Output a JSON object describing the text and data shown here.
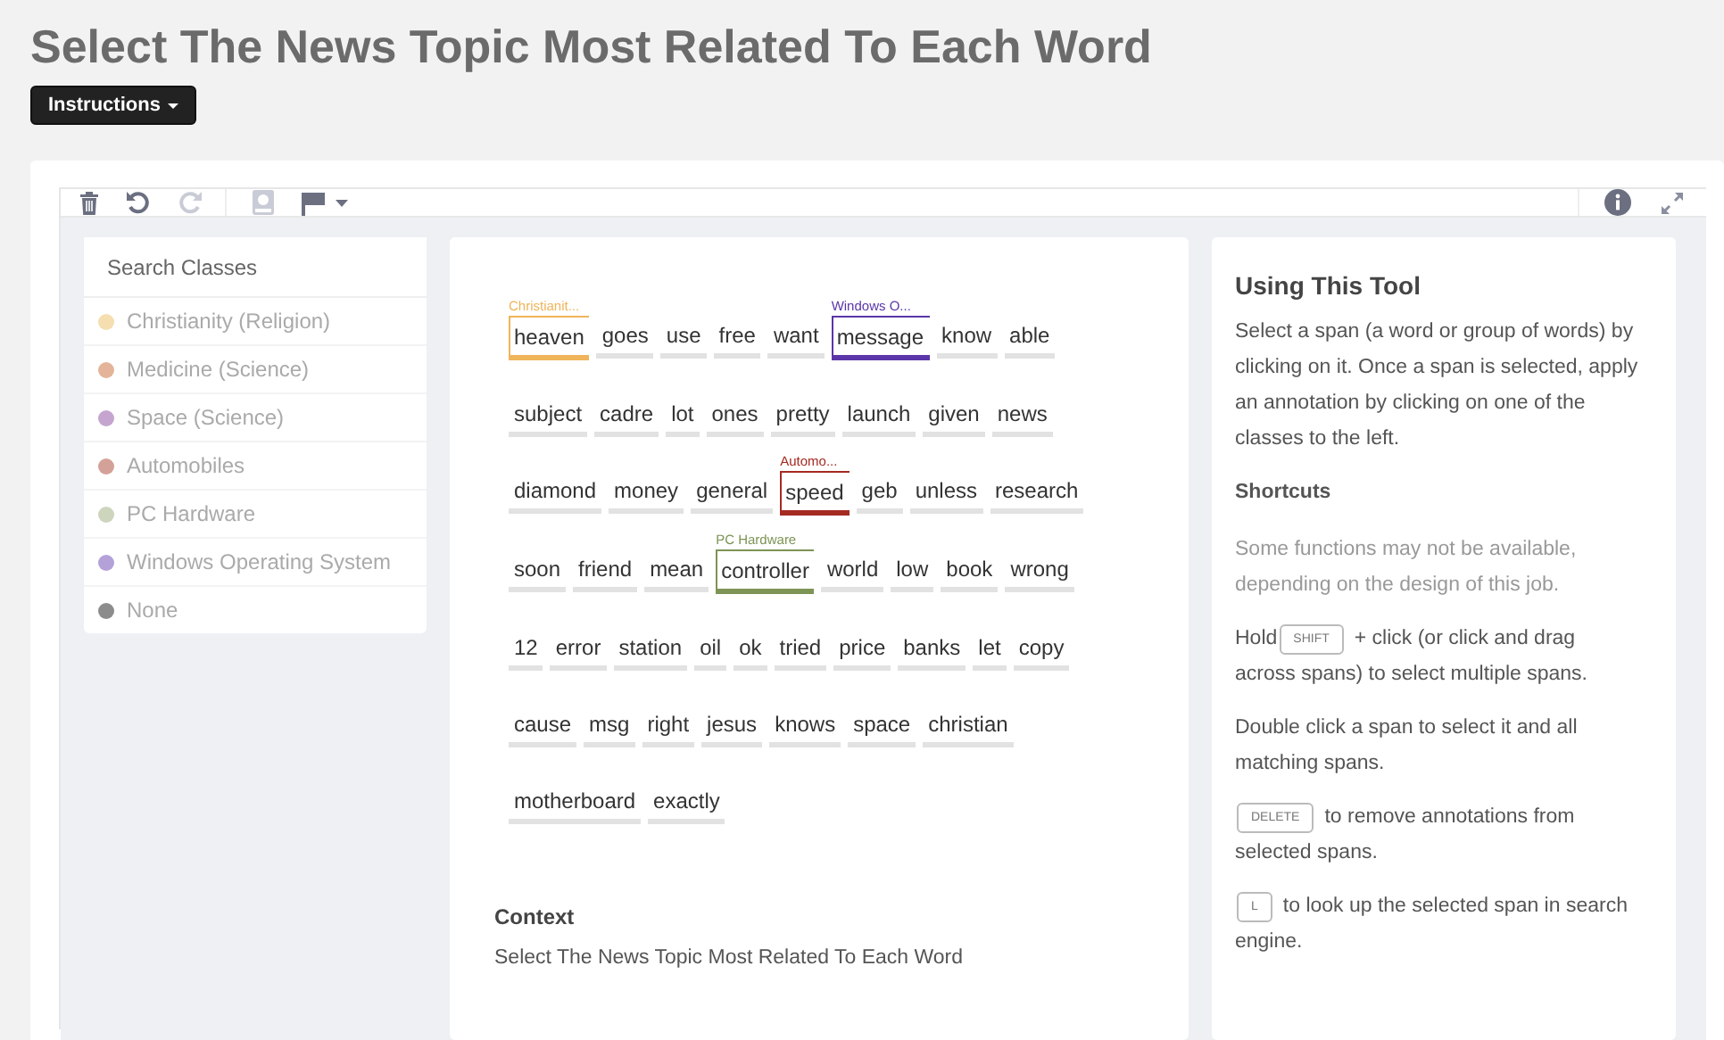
{
  "title": "Select The News Topic Most Related To Each Word",
  "instructions_button": "Instructions",
  "toolbar": {
    "undo_enabled": true,
    "redo_enabled": false
  },
  "classes": {
    "search_placeholder": "Search Classes",
    "items": [
      {
        "name": "Christianity (Religion)",
        "color": "#f5deb0"
      },
      {
        "name": "Medicine (Science)",
        "color": "#e4b49a"
      },
      {
        "name": "Space (Science)",
        "color": "#c5a5cf"
      },
      {
        "name": "Automobiles",
        "color": "#d4a198"
      },
      {
        "name": "PC Hardware",
        "color": "#cdd5bd"
      },
      {
        "name": "Windows Operating System",
        "color": "#b3a1d8"
      },
      {
        "name": "None",
        "color": "#8c8c8c"
      }
    ]
  },
  "lines": [
    [
      {
        "text": "heaven",
        "label": "Christianit...",
        "color": "#f0b45a"
      },
      {
        "text": "goes"
      },
      {
        "text": "use"
      },
      {
        "text": "free"
      },
      {
        "text": "want"
      },
      {
        "text": "message",
        "label": "Windows O...",
        "color": "#5b36a8"
      },
      {
        "text": "know"
      },
      {
        "text": "able"
      }
    ],
    [
      {
        "text": "subject"
      },
      {
        "text": "cadre"
      },
      {
        "text": "lot"
      },
      {
        "text": "ones"
      },
      {
        "text": "pretty"
      },
      {
        "text": "launch"
      },
      {
        "text": "given"
      },
      {
        "text": "news"
      }
    ],
    [
      {
        "text": "diamond"
      },
      {
        "text": "money"
      },
      {
        "text": "general"
      },
      {
        "text": "speed",
        "label": "Automo...",
        "color": "#a52a22"
      },
      {
        "text": "geb"
      },
      {
        "text": "unless"
      },
      {
        "text": "research"
      }
    ],
    [
      {
        "text": "soon"
      },
      {
        "text": "friend"
      },
      {
        "text": "mean"
      },
      {
        "text": "controller",
        "label": "PC Hardware",
        "color": "#7d9455"
      },
      {
        "text": "world"
      },
      {
        "text": "low"
      },
      {
        "text": "book"
      },
      {
        "text": "wrong"
      }
    ],
    [
      {
        "text": "12"
      },
      {
        "text": "error"
      },
      {
        "text": "station"
      },
      {
        "text": "oil"
      },
      {
        "text": "ok"
      },
      {
        "text": "tried"
      },
      {
        "text": "price"
      },
      {
        "text": "banks"
      },
      {
        "text": "let"
      },
      {
        "text": "copy"
      }
    ],
    [
      {
        "text": "cause"
      },
      {
        "text": "msg"
      },
      {
        "text": "right"
      },
      {
        "text": "jesus"
      },
      {
        "text": "knows"
      },
      {
        "text": "space"
      },
      {
        "text": "christian"
      }
    ],
    [
      {
        "text": "motherboard"
      },
      {
        "text": "exactly"
      }
    ]
  ],
  "context": {
    "heading": "Context",
    "text": "Select The News Topic Most Related To Each Word"
  },
  "help": {
    "heading": "Using This Tool",
    "intro": "Select a span (a word or group of words) by clicking on it. Once a span is selected, apply an annotation by clicking on one of the classes to the left.",
    "shortcuts_heading": "Shortcuts",
    "paragraphs": [
      {
        "muted": true,
        "parts": [
          {
            "kind": "line",
            "text": "Some functions may not be available, depending on the design of this job."
          }
        ]
      },
      {
        "muted": false,
        "parts": [
          {
            "kind": "text",
            "text": "Hold"
          },
          {
            "kind": "key",
            "text": "SHIFT"
          },
          {
            "kind": "text",
            "text": "+ click (or click and drag"
          },
          {
            "kind": "line",
            "text": "across spans) to select multiple spans."
          }
        ]
      },
      {
        "muted": false,
        "parts": [
          {
            "kind": "line",
            "text": "Double click a span to select it and all matching spans."
          }
        ]
      },
      {
        "muted": false,
        "parts": [
          {
            "kind": "key",
            "text": "DELETE"
          },
          {
            "kind": "text",
            "text": "to remove annotations from"
          },
          {
            "kind": "line",
            "text": "selected spans."
          }
        ]
      },
      {
        "muted": false,
        "parts": [
          {
            "kind": "key",
            "text": "L"
          },
          {
            "kind": "text",
            "text": "to look up the selected span in search"
          },
          {
            "kind": "line",
            "text": "engine."
          }
        ]
      }
    ]
  }
}
